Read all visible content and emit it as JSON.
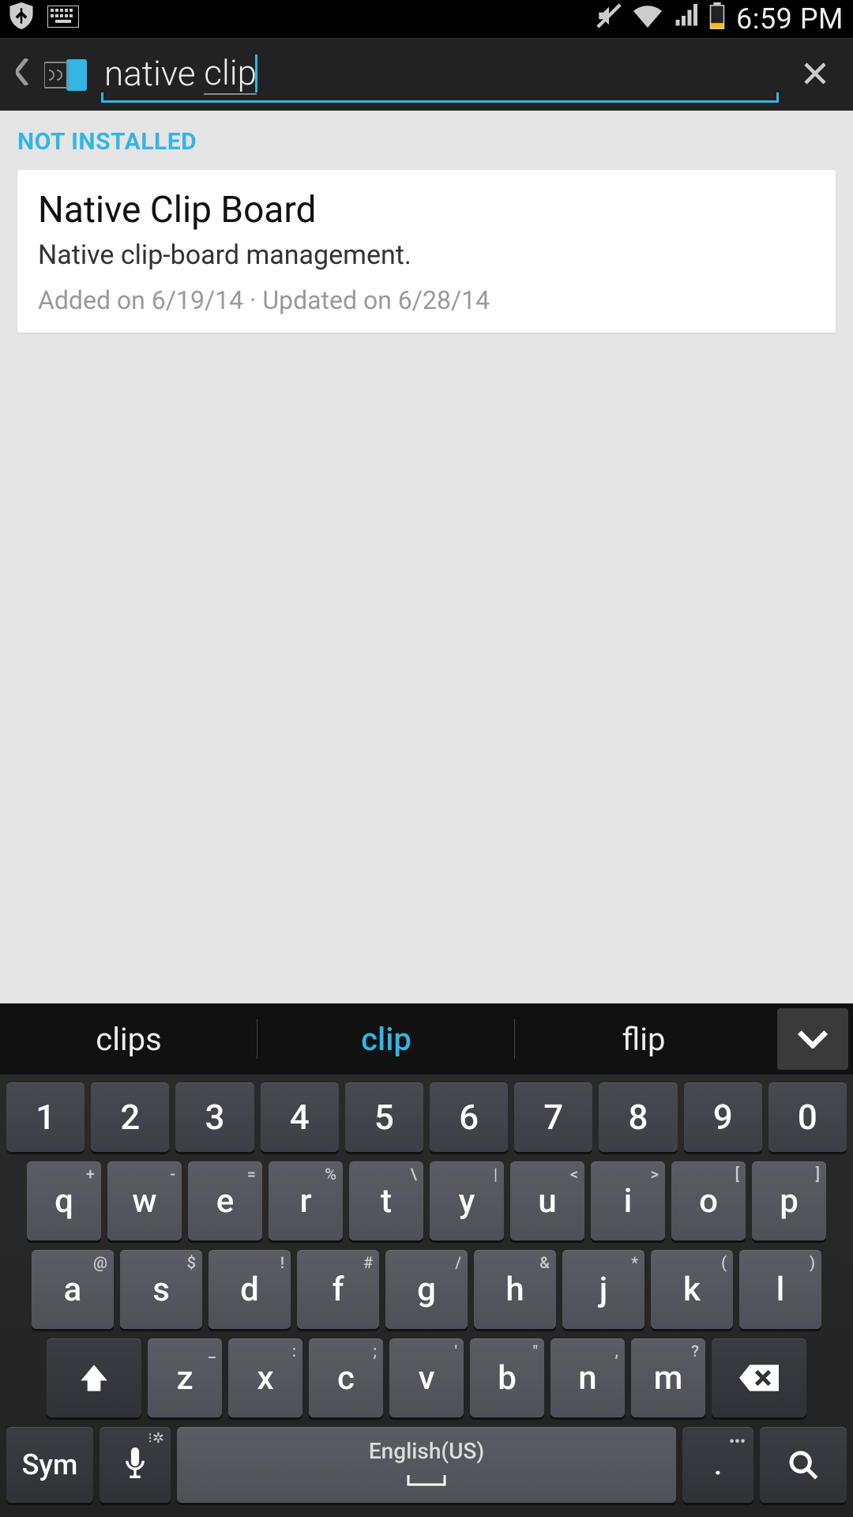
{
  "status": {
    "time": "6:59 PM"
  },
  "search": {
    "value": "native clip",
    "underlined_part": "clip"
  },
  "section_label": "NOT INSTALLED",
  "result": {
    "title": "Native Clip Board",
    "description": "Native clip-board management.",
    "meta": "Added on 6/19/14 · Updated on 6/28/14"
  },
  "suggestions": {
    "left": "clips",
    "center": "clip",
    "right": "flip"
  },
  "keyboard": {
    "row_num": [
      "1",
      "2",
      "3",
      "4",
      "5",
      "6",
      "7",
      "8",
      "9",
      "0"
    ],
    "row_q": [
      {
        "k": "q",
        "h": "+"
      },
      {
        "k": "w",
        "h": "-"
      },
      {
        "k": "e",
        "h": "="
      },
      {
        "k": "r",
        "h": "%"
      },
      {
        "k": "t",
        "h": "\\"
      },
      {
        "k": "y",
        "h": "|"
      },
      {
        "k": "u",
        "h": "<"
      },
      {
        "k": "i",
        "h": ">"
      },
      {
        "k": "o",
        "h": "["
      },
      {
        "k": "p",
        "h": "]"
      }
    ],
    "row_a": [
      {
        "k": "a",
        "h": "@"
      },
      {
        "k": "s",
        "h": "$"
      },
      {
        "k": "d",
        "h": "!"
      },
      {
        "k": "f",
        "h": "#"
      },
      {
        "k": "g",
        "h": "/"
      },
      {
        "k": "h",
        "h": "&"
      },
      {
        "k": "j",
        "h": "*"
      },
      {
        "k": "k",
        "h": "("
      },
      {
        "k": "l",
        "h": ")"
      }
    ],
    "row_z": [
      {
        "k": "z",
        "h": "_"
      },
      {
        "k": "x",
        "h": ":"
      },
      {
        "k": "c",
        "h": ";"
      },
      {
        "k": "v",
        "h": "'"
      },
      {
        "k": "b",
        "h": "\""
      },
      {
        "k": "n",
        "h": ","
      },
      {
        "k": "m",
        "h": "?"
      }
    ],
    "sym": "Sym",
    "space": "English(US)",
    "dot": "."
  },
  "colors": {
    "accent": "#33b5e5"
  }
}
